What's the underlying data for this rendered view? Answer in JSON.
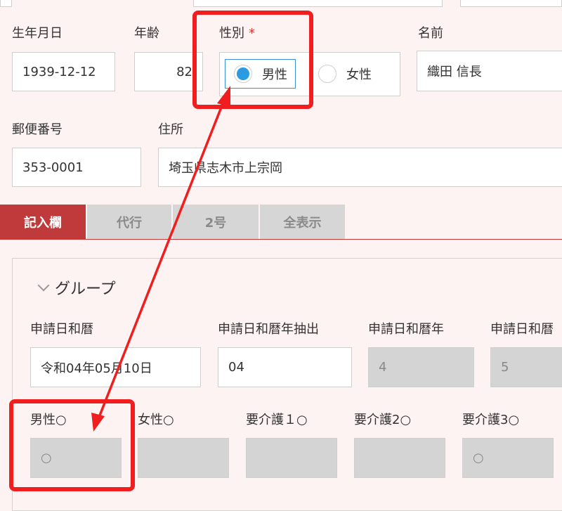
{
  "personal": {
    "birth_label": "生年月日",
    "birth_value": "1939-12-12",
    "age_label": "年齢",
    "age_value": "82",
    "gender_label": "性別",
    "gender_required": "*",
    "gender_options": [
      "男性",
      "女性"
    ],
    "gender_selected": "男性",
    "name_label": "名前",
    "name_value": "織田 信長",
    "postal_label": "郵便番号",
    "postal_value": "353-0001",
    "address_label": "住所",
    "address_value": "埼玉県志木市上宗岡"
  },
  "tabs": [
    {
      "label": "記入欄",
      "active": true
    },
    {
      "label": "代行",
      "active": false
    },
    {
      "label": "2号",
      "active": false
    },
    {
      "label": "全表示",
      "active": false
    }
  ],
  "group": {
    "title": "グループ",
    "fields_row1": [
      {
        "label": "申請日和暦",
        "value": "令和04年05月10日",
        "readonly": false
      },
      {
        "label": "申請日和暦年抽出",
        "value": "04",
        "readonly": false
      },
      {
        "label": "申請日和暦年",
        "value": "4",
        "readonly": true
      },
      {
        "label": "申請日和暦",
        "value": "5",
        "readonly": true
      }
    ],
    "fields_row2": [
      {
        "label": "男性○",
        "value": "○"
      },
      {
        "label": "女性○",
        "value": ""
      },
      {
        "label": "要介護１○",
        "value": ""
      },
      {
        "label": "要介護2○",
        "value": ""
      },
      {
        "label": "要介護3○",
        "value": "○"
      }
    ]
  },
  "annotation": {
    "color": "#f01e1e"
  }
}
